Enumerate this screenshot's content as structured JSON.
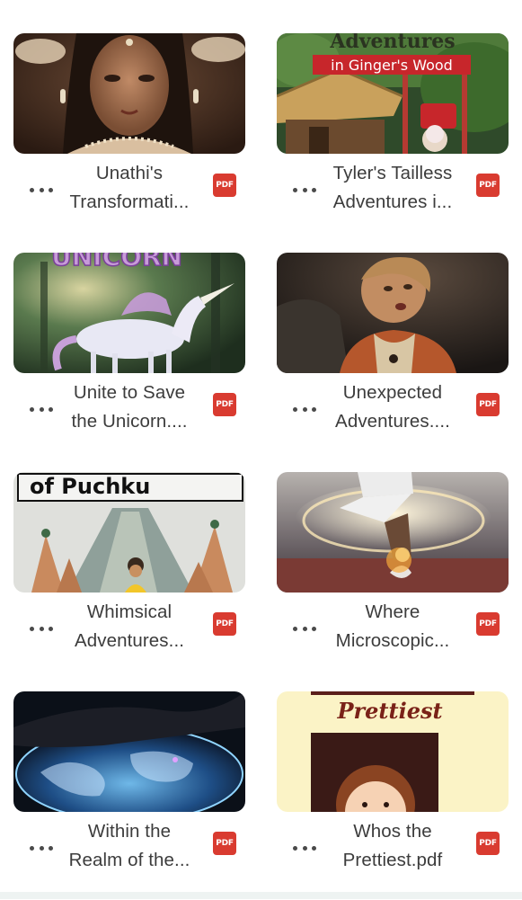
{
  "files": [
    {
      "title_line1": "Unathi's",
      "title_line2": "Transformati...",
      "type_badge": "PDF",
      "thumb_icon": "portrait-thumbnail"
    },
    {
      "title_line1": "Tyler's Tailless",
      "title_line2": "Adventures i...",
      "type_badge": "PDF",
      "thumb_icon": "cottage-thumbnail",
      "thumb_text_1": "Adventures",
      "thumb_text_2": "in Ginger's Wood"
    },
    {
      "title_line1": "Unite to Save",
      "title_line2": "the Unicorn....",
      "type_badge": "PDF",
      "thumb_icon": "unicorn-thumbnail",
      "thumb_text_1": "UNICORN"
    },
    {
      "title_line1": "Unexpected",
      "title_line2": "Adventures....",
      "type_badge": "PDF",
      "thumb_icon": "boy-looking-up-thumbnail"
    },
    {
      "title_line1": "Whimsical",
      "title_line2": "Adventures...",
      "type_badge": "PDF",
      "thumb_icon": "mountain-thumbnail",
      "thumb_text_1": "of Puchku"
    },
    {
      "title_line1": "Where",
      "title_line2": "Microscopic...",
      "type_badge": "PDF",
      "thumb_icon": "magic-portal-thumbnail"
    },
    {
      "title_line1": "Within the",
      "title_line2": "Realm of the...",
      "type_badge": "PDF",
      "thumb_icon": "globe-hologram-thumbnail"
    },
    {
      "title_line1": "Whos the",
      "title_line2": "Prettiest.pdf",
      "type_badge": "PDF",
      "thumb_icon": "girl-portrait-thumbnail",
      "thumb_text_1": "Prettiest"
    }
  ],
  "colors": {
    "pdf_badge": "#d93b30",
    "title_text": "#3c3c3c",
    "more_dots": "#4a4a4a"
  }
}
